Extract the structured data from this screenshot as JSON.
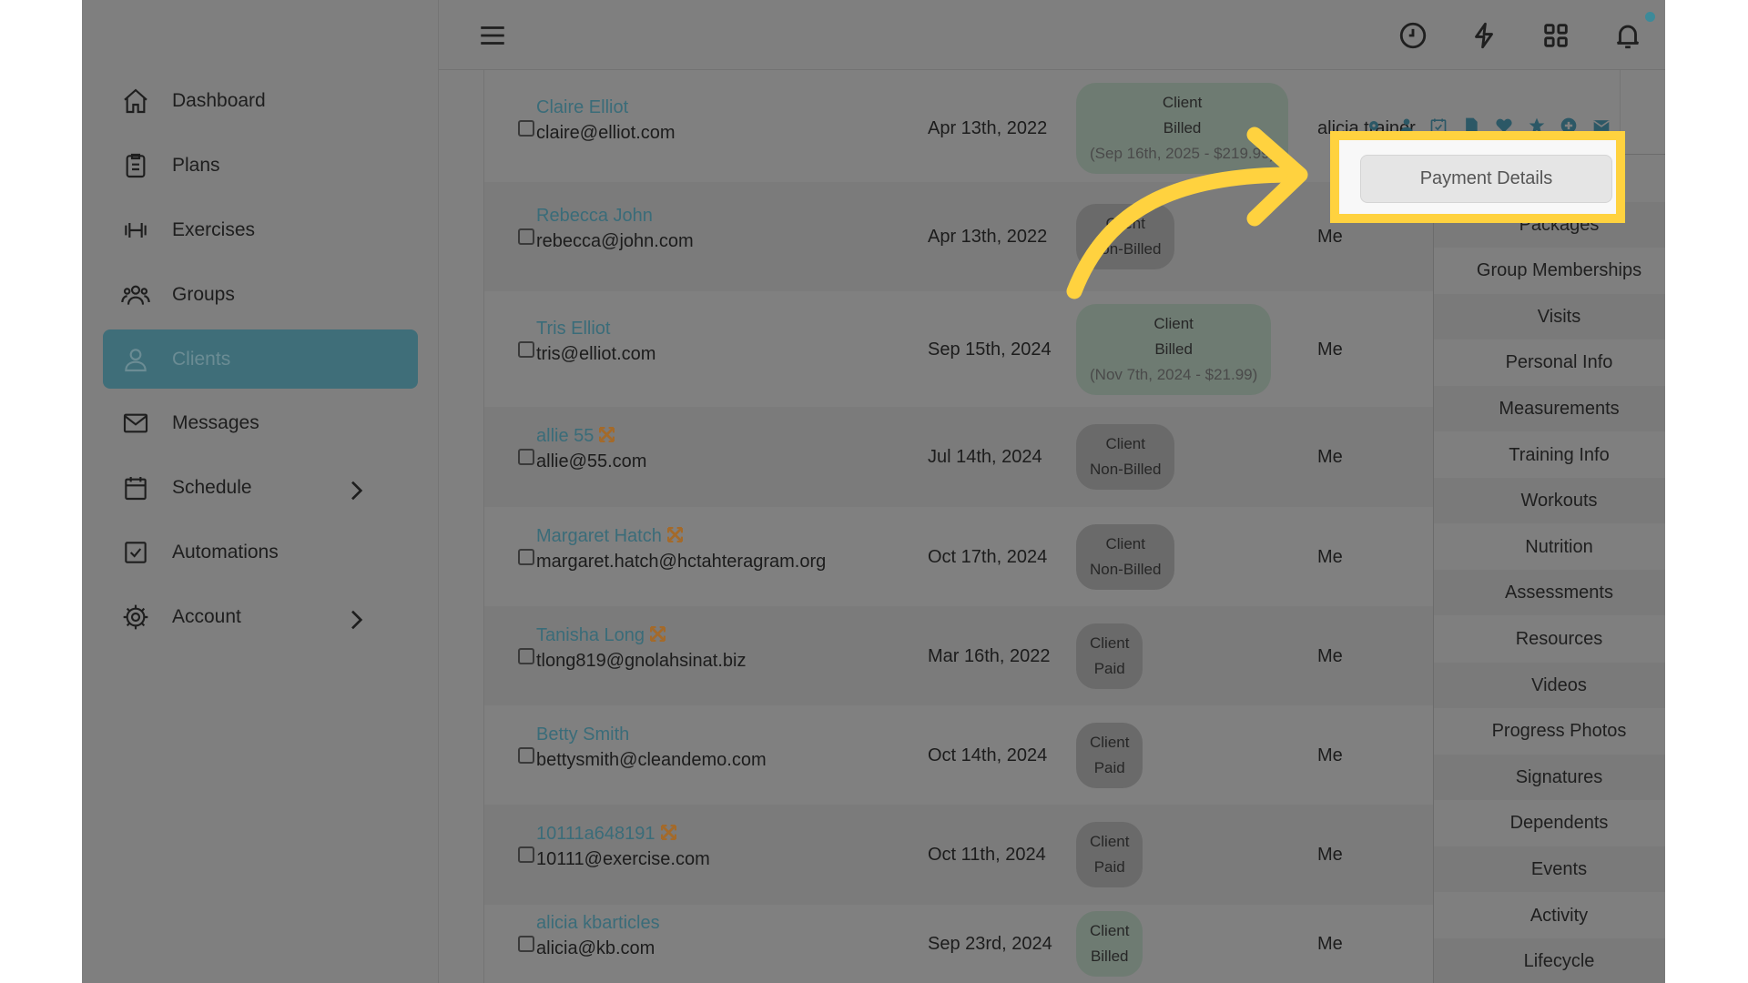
{
  "sidebar": {
    "items": [
      {
        "label": "Dashboard",
        "icon": "home-icon"
      },
      {
        "label": "Plans",
        "icon": "clipboard-icon"
      },
      {
        "label": "Exercises",
        "icon": "dumbbell-icon"
      },
      {
        "label": "Groups",
        "icon": "users-icon"
      },
      {
        "label": "Clients",
        "icon": "user-icon",
        "active": true
      },
      {
        "label": "Messages",
        "icon": "envelope-icon"
      },
      {
        "label": "Schedule",
        "icon": "calendar-icon",
        "has_submenu": true
      },
      {
        "label": "Automations",
        "icon": "checkbox-icon"
      },
      {
        "label": "Account",
        "icon": "gear-icon",
        "has_submenu": true
      }
    ]
  },
  "header": {
    "icons": [
      "menu-icon",
      "clock-icon",
      "bolt-icon",
      "grid-icon",
      "bell-icon",
      "avatar"
    ],
    "notification_dot_color": "#3d8a99"
  },
  "clients": [
    {
      "name": "Claire Elliot",
      "email": "claire@elliot.com",
      "date": "Apr 13th, 2022",
      "status1": "Client",
      "status2": "Billed",
      "status3": "(Sep 16th, 2025 - $219.99)",
      "trainer": "alicia trainer",
      "flag": false
    },
    {
      "name": "Rebecca John",
      "email": "rebecca@john.com",
      "date": "Apr 13th, 2022",
      "status1": "Client",
      "status2": "Non-Billed",
      "trainer": "Me",
      "flag": false
    },
    {
      "name": "Tris Elliot",
      "email": "tris@elliot.com",
      "date": "Sep 15th, 2024",
      "status1": "Client",
      "status2": "Billed",
      "status3": "(Nov 7th, 2024 - $21.99)",
      "trainer": "Me",
      "flag": false
    },
    {
      "name": "allie 55",
      "email": "allie@55.com",
      "date": "Jul 14th, 2024",
      "status1": "Client",
      "status2": "Non-Billed",
      "trainer": "Me",
      "flag": true
    },
    {
      "name": "Margaret Hatch",
      "email": "margaret.hatch@hctahteragram.org",
      "date": "Oct 17th, 2024",
      "status1": "Client",
      "status2": "Non-Billed",
      "trainer": "Me",
      "flag": true
    },
    {
      "name": "Tanisha Long",
      "email": "tlong819@gnolahsinat.biz",
      "date": "Mar 16th, 2022",
      "status1": "Client",
      "status2": "Paid",
      "trainer": "Me",
      "flag": true
    },
    {
      "name": "Betty Smith",
      "email": "bettysmith@cleandemo.com",
      "date": "Oct 14th, 2024",
      "status1": "Client",
      "status2": "Paid",
      "trainer": "Me",
      "flag": false
    },
    {
      "name": "10111a648191",
      "email": "10111@exercise.com",
      "date": "Oct 11th, 2024",
      "status1": "Client",
      "status2": "Paid",
      "trainer": "Me",
      "flag": true
    },
    {
      "name": "alicia kbarticles",
      "email": "alicia@kb.com",
      "date": "Sep 23rd, 2024",
      "status1": "Client",
      "status2": "Billed",
      "trainer": "Me",
      "flag": false
    }
  ],
  "row_action_icons": [
    "gear-icon",
    "user-icon",
    "calendar-check-icon",
    "file-icon",
    "heartbeat-icon",
    "star-icon",
    "plus-circle-icon",
    "envelope-icon"
  ],
  "dropdown": {
    "items": [
      "Payment Details",
      "Packages",
      "Group Memberships",
      "Visits",
      "Personal Info",
      "Measurements",
      "Training Info",
      "Workouts",
      "Nutrition",
      "Assessments",
      "Resources",
      "Videos",
      "Progress Photos",
      "Signatures",
      "Dependents",
      "Events",
      "Activity",
      "Lifecycle"
    ],
    "highlighted": "Payment Details"
  },
  "colors": {
    "accent": "#3f6e79",
    "highlight": "#ffd23f",
    "link": "#3a6c79"
  }
}
